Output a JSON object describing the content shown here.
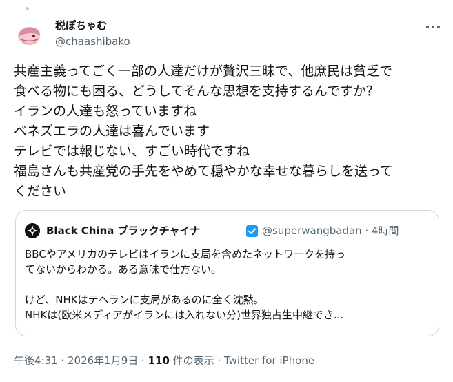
{
  "author": {
    "display_name": "税ぽちゃむ",
    "handle": "@chaashibako",
    "avatar_icon": "pink-cartoon-avatar"
  },
  "more_icon": "more-horizontal-icon",
  "tweet_lines": [
    "共産主義ってごく一部の人達だけが贅沢三昧で、他庶民は貧乏で",
    "食べる物にも困る、どうしてそんな思想を支持するんですか？",
    "イランの人達も怒っていますね",
    "ベネズエラの人達は喜んでいます",
    "テレビでは報じない、すごい時代ですね",
    "福島さんも共産党の手先をやめて穏やかな幸せな暮らしを送って",
    "ください"
  ],
  "quote": {
    "display_name": "Black China ブラックチャイナ",
    "verified_icon": "verified-badge-icon",
    "meta": "@superwangbadan · 4時間",
    "lines": [
      "BBCやアメリカのテレビはイランに支局を含めたネットワークを持っ",
      "てないからわかる。ある意味で仕方ない。",
      "",
      "けど、NHKはテヘランに支局があるのに全く沈黙。",
      "NHKは(欧米メディアがイランには入れない分)世界独占生中継でき..."
    ]
  },
  "footer": {
    "time": "午後4:31",
    "sep1": " · ",
    "date": "2026年1月9日",
    "sep2": " · ",
    "views_count": "110",
    "views_label": " 件の表示",
    "sep3": " · ",
    "source": "Twitter for iPhone"
  },
  "colors": {
    "text": "#0f1419",
    "secondary": "#536471",
    "border": "#cfd9de",
    "verified": "#1d9bf0"
  }
}
